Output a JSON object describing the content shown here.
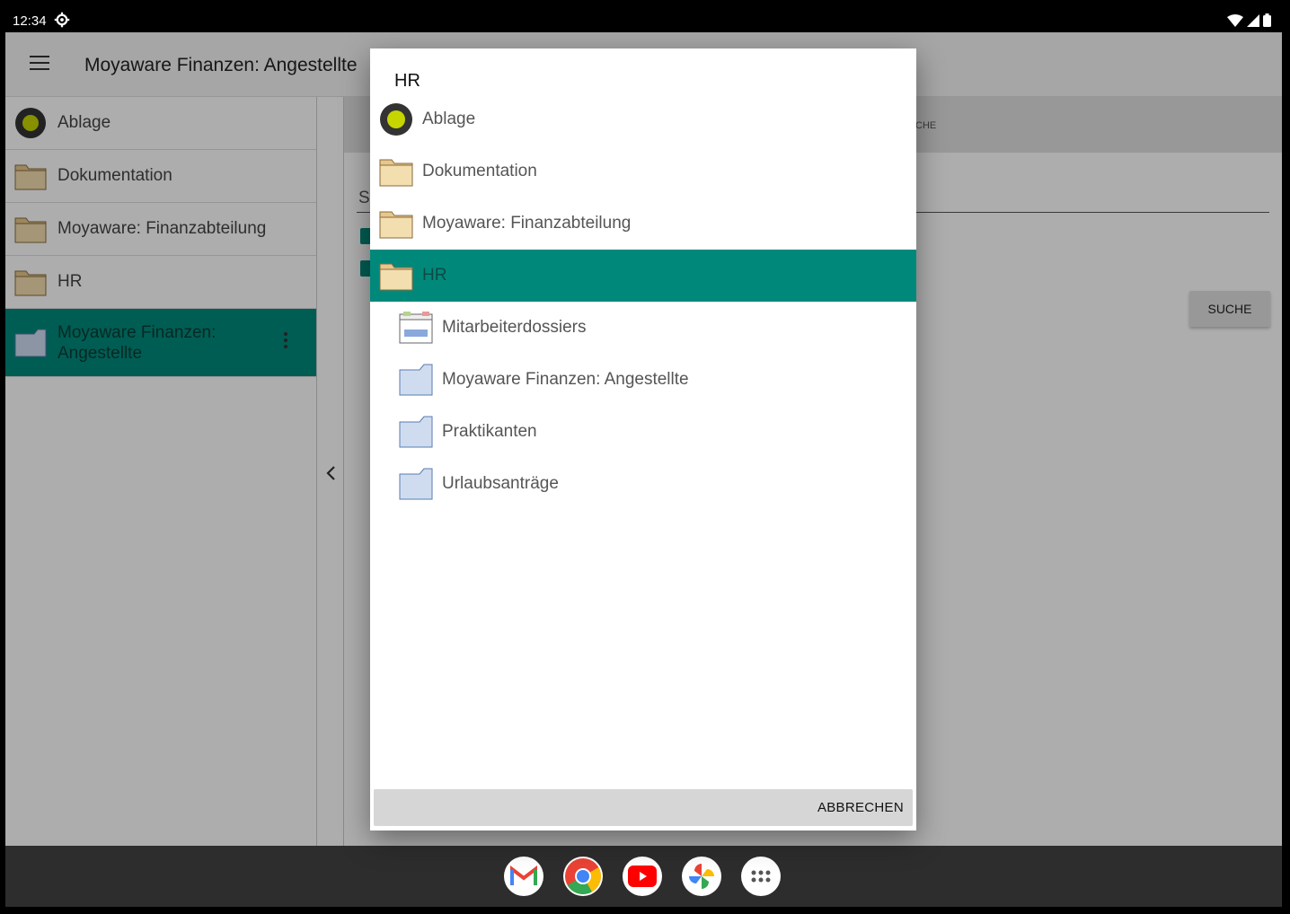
{
  "status": {
    "time": "12:34"
  },
  "toolbar": {
    "title": "Moyaware Finanzen: Angestellte"
  },
  "sidebar": {
    "items": [
      {
        "label": "Ablage",
        "icon": "root-circle-icon"
      },
      {
        "label": "Dokumentation",
        "icon": "folder-icon"
      },
      {
        "label": "Moyaware: Finanzabteilung",
        "icon": "folder-icon"
      },
      {
        "label": "HR",
        "icon": "folder-icon"
      },
      {
        "label": "Moyaware Finanzen: Angestellte",
        "icon": "blue-folder-icon",
        "active": true
      }
    ]
  },
  "content": {
    "tab_fragment": "CHE",
    "search_fragment": "S",
    "search_button": "SUCHE"
  },
  "dialog": {
    "title": "HR",
    "items": [
      {
        "label": "Ablage",
        "icon": "root-circle-icon",
        "level": 0
      },
      {
        "label": "Dokumentation",
        "icon": "folder-icon",
        "level": 0
      },
      {
        "label": "Moyaware: Finanzabteilung",
        "icon": "folder-icon",
        "level": 0
      },
      {
        "label": "HR",
        "icon": "folder-icon",
        "level": 0,
        "selected": true
      },
      {
        "label": "Mitarbeiterdossiers",
        "icon": "dossier-icon",
        "level": 1
      },
      {
        "label": "Moyaware Finanzen: Angestellte",
        "icon": "blue-folder-icon",
        "level": 1
      },
      {
        "label": "Praktikanten",
        "icon": "blue-folder-icon",
        "level": 1
      },
      {
        "label": "Urlaubsanträge",
        "icon": "blue-folder-icon",
        "level": 1
      }
    ],
    "cancel_label": "ABBRECHEN"
  },
  "dock": {
    "apps": [
      "gmail-icon",
      "chrome-icon",
      "youtube-icon",
      "photos-icon",
      "app-drawer-icon"
    ]
  },
  "colors": {
    "accent": "#00897b",
    "folder": "#f3deb0",
    "blue_folder": "#cfdcf0"
  }
}
